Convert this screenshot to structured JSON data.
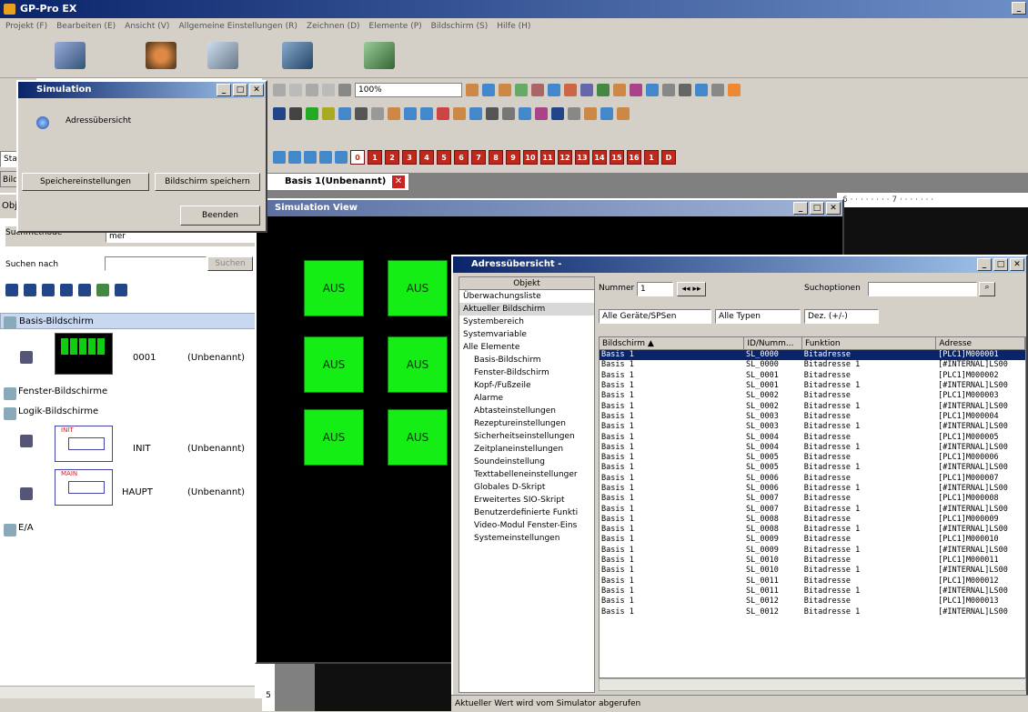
{
  "app": {
    "title": "GP-Pro EX"
  },
  "menu": [
    "Projekt (F)",
    "Bearbeiten (E)",
    "Ansicht (V)",
    "Allgemeine Einstellungen (R)",
    "Zeichnen (D)",
    "Elemente (P)",
    "Bildschirm (S)",
    "Hilfe (H)"
  ],
  "toolbar": {
    "zoom": "100%",
    "screen_numbers": [
      "0",
      "1",
      "2",
      "3",
      "4",
      "5",
      "6",
      "7",
      "8",
      "9",
      "10",
      "11",
      "12",
      "13",
      "14",
      "15",
      "16",
      "1",
      "D"
    ]
  },
  "simulation": {
    "title": "Simulation",
    "address_label": "Adressübersicht",
    "mem_button": "Speichereinstellungen",
    "save_button": "Bildschirm speichern",
    "end_button": "Beenden"
  },
  "left": {
    "tab_stat": "Stat",
    "tab_bild": "Bilds",
    "tab_obj": "Obje",
    "search_method": "Suchmethode",
    "search_method_value": "mer",
    "search_for": "Suchen nach",
    "search_button": "Suchen",
    "bottom_tab": "5",
    "tree": {
      "basis": "Basis-Bildschirm",
      "screen_no": "0001",
      "unnamed": "(Unbenannt)",
      "fenster": "Fenster-Bildschirme",
      "logik": "Logik-Bildschirme",
      "init_tag": "INIT",
      "init": "INIT",
      "main_tag": "MAIN",
      "haupt": "HAUPT",
      "ea": "E/A"
    }
  },
  "doc_tab": {
    "label": "Basis 1(Unbenannt)"
  },
  "ruler": "6 · · · · · · · · 7 · · · · · · ·",
  "sim_view": {
    "title": "Simulation View",
    "button_label": "AUS"
  },
  "address": {
    "title": "Adressübersicht -",
    "object_header": "Objekt",
    "objects": [
      "Überwachungsliste",
      "Aktueller Bildschirm",
      "Systembereich",
      "Systemvariable",
      "Alle Elemente",
      "Basis-Bildschirm",
      "Fenster-Bildschirm",
      "Kopf-/Fußzeile",
      "Alarme",
      "Abtasteinstellungen",
      "Rezeptureinstellungen",
      "Sicherheitseinstellungen",
      "Zeitplaneinstellungen",
      "Soundeinstellung",
      "Texttabelleneinstellunger",
      "Globales D-Skript",
      "Erweitertes SIO-Skript",
      "Benutzerdefinierte Funkti",
      "Video-Modul Fenster-Eins",
      "Systemeinstellungen"
    ],
    "nummer_label": "Nummer",
    "nummer_value": "1",
    "search_options": "Suchoptionen",
    "filter_devices": "Alle Geräte/SPSen",
    "filter_types": "Alle Typen",
    "filter_format": "Dez. (+/-)",
    "columns": [
      "Bildschirm  ▲",
      "ID/Numm...",
      "Funktion",
      "Adresse"
    ],
    "rows": [
      [
        "Basis 1",
        "SL_0000",
        "Bitadresse",
        "[PLC1]M000001"
      ],
      [
        "Basis 1",
        "SL_0000",
        "Bitadresse 1",
        "[#INTERNAL]LS00"
      ],
      [
        "Basis 1",
        "SL_0001",
        "Bitadresse",
        "[PLC1]M000002"
      ],
      [
        "Basis 1",
        "SL_0001",
        "Bitadresse 1",
        "[#INTERNAL]LS00"
      ],
      [
        "Basis 1",
        "SL_0002",
        "Bitadresse",
        "[PLC1]M000003"
      ],
      [
        "Basis 1",
        "SL_0002",
        "Bitadresse 1",
        "[#INTERNAL]LS00"
      ],
      [
        "Basis 1",
        "SL_0003",
        "Bitadresse",
        "[PLC1]M000004"
      ],
      [
        "Basis 1",
        "SL_0003",
        "Bitadresse 1",
        "[#INTERNAL]LS00"
      ],
      [
        "Basis 1",
        "SL_0004",
        "Bitadresse",
        "[PLC1]M000005"
      ],
      [
        "Basis 1",
        "SL_0004",
        "Bitadresse 1",
        "[#INTERNAL]LS00"
      ],
      [
        "Basis 1",
        "SL_0005",
        "Bitadresse",
        "[PLC1]M000006"
      ],
      [
        "Basis 1",
        "SL_0005",
        "Bitadresse 1",
        "[#INTERNAL]LS00"
      ],
      [
        "Basis 1",
        "SL_0006",
        "Bitadresse",
        "[PLC1]M000007"
      ],
      [
        "Basis 1",
        "SL_0006",
        "Bitadresse 1",
        "[#INTERNAL]LS00"
      ],
      [
        "Basis 1",
        "SL_0007",
        "Bitadresse",
        "[PLC1]M000008"
      ],
      [
        "Basis 1",
        "SL_0007",
        "Bitadresse 1",
        "[#INTERNAL]LS00"
      ],
      [
        "Basis 1",
        "SL_0008",
        "Bitadresse",
        "[PLC1]M000009"
      ],
      [
        "Basis 1",
        "SL_0008",
        "Bitadresse 1",
        "[#INTERNAL]LS00"
      ],
      [
        "Basis 1",
        "SL_0009",
        "Bitadresse",
        "[PLC1]M000010"
      ],
      [
        "Basis 1",
        "SL_0009",
        "Bitadresse 1",
        "[#INTERNAL]LS00"
      ],
      [
        "Basis 1",
        "SL_0010",
        "Bitadresse",
        "[PLC1]M000011"
      ],
      [
        "Basis 1",
        "SL_0010",
        "Bitadresse 1",
        "[#INTERNAL]LS00"
      ],
      [
        "Basis 1",
        "SL_0011",
        "Bitadresse",
        "[PLC1]M000012"
      ],
      [
        "Basis 1",
        "SL_0011",
        "Bitadresse 1",
        "[#INTERNAL]LS00"
      ],
      [
        "Basis 1",
        "SL_0012",
        "Bitadresse",
        "[PLC1]M000013"
      ],
      [
        "Basis 1",
        "SL_0012",
        "Bitadresse 1",
        "[#INTERNAL]LS00"
      ]
    ],
    "status": "Aktueller Wert wird vom Simulator abgerufen"
  }
}
